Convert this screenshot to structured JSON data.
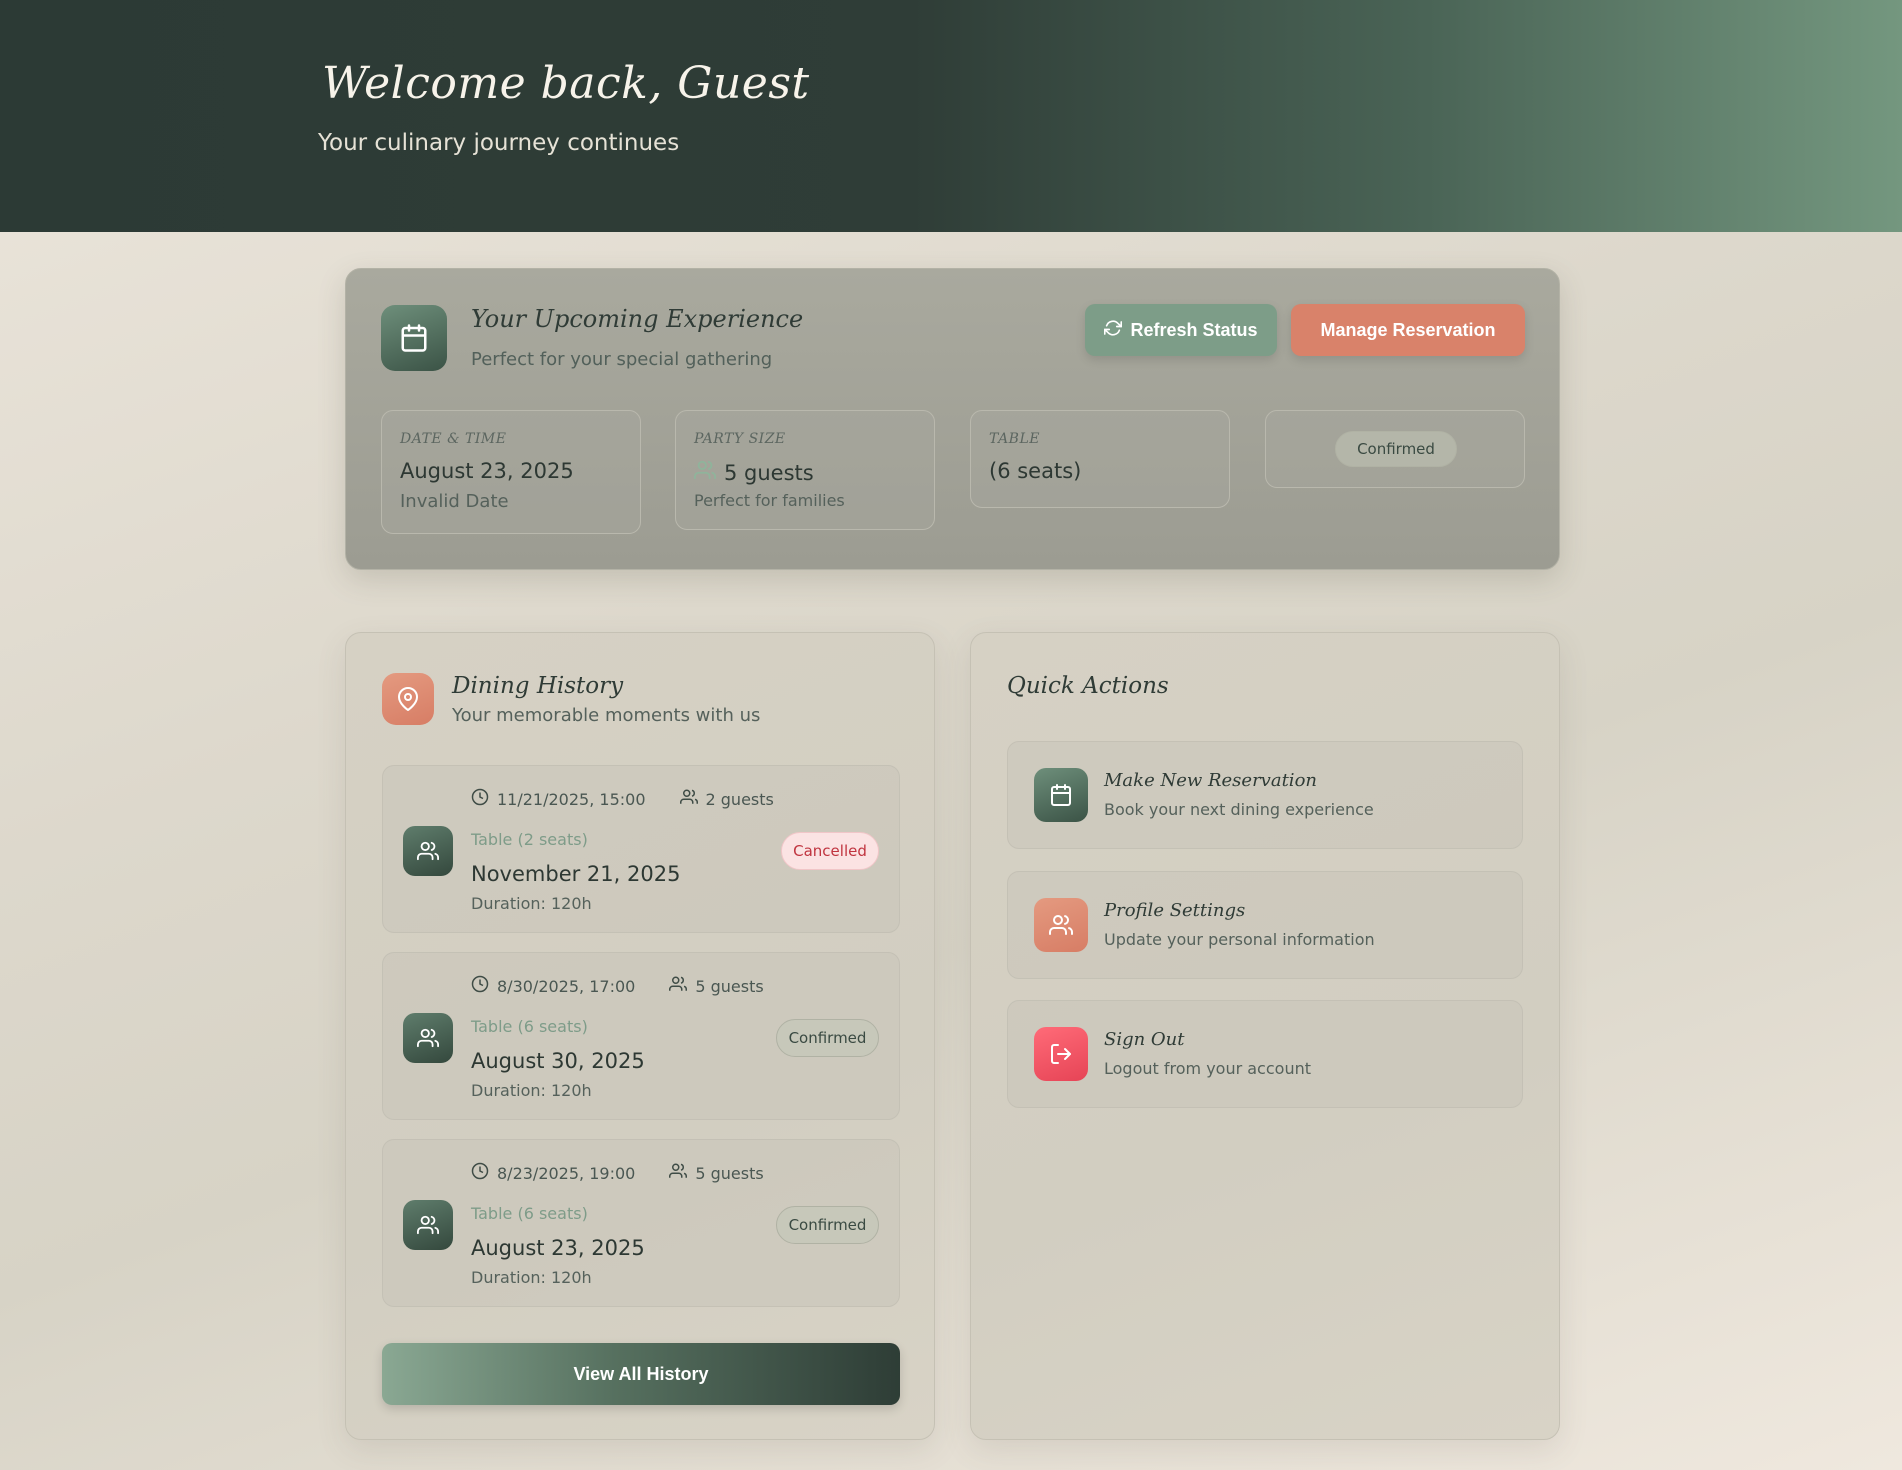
{
  "header": {
    "title": "Welcome back, Guest",
    "subtitle": "Your culinary journey continues"
  },
  "upcoming": {
    "title": "Your Upcoming Experience",
    "subtitle": "Perfect for your special gathering",
    "refresh_label": "Refresh Status",
    "manage_label": "Manage Reservation",
    "date_time": {
      "label": "DATE & TIME",
      "value": "August 23, 2025",
      "sub": "Invalid Date"
    },
    "party_size": {
      "label": "PARTY SIZE",
      "value": "5 guests",
      "sub": "Perfect for families"
    },
    "table": {
      "label": "TABLE",
      "value": "(6 seats)"
    },
    "status": "Confirmed"
  },
  "history": {
    "title": "Dining History",
    "subtitle": "Your memorable moments with us",
    "items": [
      {
        "datetime": "11/21/2025, 15:00",
        "guests": "2 guests",
        "table": "Table (2 seats)",
        "date": "November 21, 2025",
        "duration": "Duration: 120h",
        "status": "Cancelled"
      },
      {
        "datetime": "8/30/2025, 17:00",
        "guests": "5 guests",
        "table": "Table (6 seats)",
        "date": "August 30, 2025",
        "duration": "Duration: 120h",
        "status": "Confirmed"
      },
      {
        "datetime": "8/23/2025, 19:00",
        "guests": "5 guests",
        "table": "Table (6 seats)",
        "date": "August 23, 2025",
        "duration": "Duration: 120h",
        "status": "Confirmed"
      }
    ],
    "view_all_label": "View All History"
  },
  "quick_actions": {
    "title": "Quick Actions",
    "items": [
      {
        "title": "Make New Reservation",
        "subtitle": "Book your next dining experience"
      },
      {
        "title": "Profile Settings",
        "subtitle": "Update your personal information"
      },
      {
        "title": "Sign Out",
        "subtitle": "Logout from your account"
      }
    ]
  },
  "icons": {
    "upcoming": "calendar-icon",
    "refresh": "refresh-icon",
    "guests": "users-icon",
    "history": "map-pin-icon",
    "clock": "clock-icon",
    "profile": "users-icon",
    "signout": "log-out-icon"
  },
  "colors": {
    "accent_green": "#7d9d88",
    "accent_coral": "#d9826a",
    "danger": "#e64456"
  }
}
